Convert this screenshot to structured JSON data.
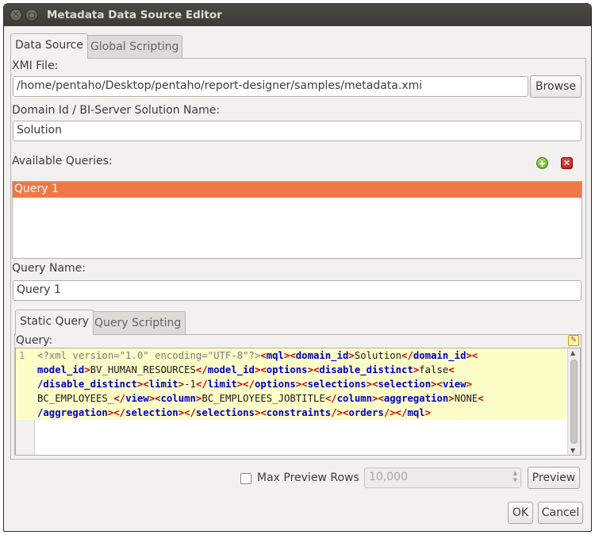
{
  "window": {
    "title": "Metadata Data Source Editor"
  },
  "tabs": [
    {
      "label": "Data Source"
    },
    {
      "label": "Global Scripting"
    }
  ],
  "xmi": {
    "label": "XMI File:",
    "value": "/home/pentaho/Desktop/pentaho/report-designer/samples/metadata.xmi",
    "browse_label": "Browse"
  },
  "domain": {
    "label": "Domain Id / BI-Server Solution Name:",
    "value": "Solution"
  },
  "queries": {
    "label": "Available Queries:",
    "items": [
      "Query 1"
    ]
  },
  "query_name": {
    "label": "Query Name:",
    "value": "Query 1"
  },
  "query_tabs": [
    {
      "label": "Static Query"
    },
    {
      "label": "Query Scripting"
    }
  ],
  "query": {
    "label": "Query:",
    "line_number": "1",
    "lines": [
      [
        [
          "pi",
          "<?xml version=\"1.0\" encoding=\"UTF-8\"?>"
        ],
        [
          "br",
          "<"
        ],
        [
          "tag",
          "mql"
        ],
        [
          "br",
          ">"
        ],
        [
          "br",
          "<"
        ],
        [
          "tag",
          "domain_id"
        ],
        [
          "br",
          ">"
        ],
        [
          "txt",
          "Solution"
        ],
        [
          "br",
          "</"
        ],
        [
          "tag",
          "domain_id"
        ],
        [
          "br",
          ">"
        ],
        [
          "br",
          "<"
        ]
      ],
      [
        [
          "tag",
          "model_id"
        ],
        [
          "br",
          ">"
        ],
        [
          "txt",
          "BV_HUMAN_RESOURCES"
        ],
        [
          "br",
          "</"
        ],
        [
          "tag",
          "model_id"
        ],
        [
          "br",
          ">"
        ],
        [
          "br",
          "<"
        ],
        [
          "tag",
          "options"
        ],
        [
          "br",
          ">"
        ],
        [
          "br",
          "<"
        ],
        [
          "tag",
          "disable_distinct"
        ],
        [
          "br",
          ">"
        ],
        [
          "txt",
          "false"
        ],
        [
          "br",
          "<"
        ]
      ],
      [
        [
          "tag",
          "/disable_distinct"
        ],
        [
          "br",
          ">"
        ],
        [
          "br",
          "<"
        ],
        [
          "tag",
          "limit"
        ],
        [
          "br",
          ">"
        ],
        [
          "txt",
          "-1"
        ],
        [
          "br",
          "</"
        ],
        [
          "tag",
          "limit"
        ],
        [
          "br",
          ">"
        ],
        [
          "br",
          "</"
        ],
        [
          "tag",
          "options"
        ],
        [
          "br",
          ">"
        ],
        [
          "br",
          "<"
        ],
        [
          "tag",
          "selections"
        ],
        [
          "br",
          ">"
        ],
        [
          "br",
          "<"
        ],
        [
          "tag",
          "selection"
        ],
        [
          "br",
          ">"
        ],
        [
          "br",
          "<"
        ],
        [
          "tag",
          "view"
        ],
        [
          "br",
          ">"
        ]
      ],
      [
        [
          "txt",
          "BC_EMPLOYEES_"
        ],
        [
          "br",
          "</"
        ],
        [
          "tag",
          "view"
        ],
        [
          "br",
          ">"
        ],
        [
          "br",
          "<"
        ],
        [
          "tag",
          "column"
        ],
        [
          "br",
          ">"
        ],
        [
          "txt",
          "BC_EMPLOYEES_JOBTITLE"
        ],
        [
          "br",
          "</"
        ],
        [
          "tag",
          "column"
        ],
        [
          "br",
          ">"
        ],
        [
          "br",
          "<"
        ],
        [
          "tag",
          "aggregation"
        ],
        [
          "br",
          ">"
        ],
        [
          "txt",
          "NONE"
        ],
        [
          "br",
          "<"
        ]
      ],
      [
        [
          "tag",
          "/aggregation"
        ],
        [
          "br",
          ">"
        ],
        [
          "br",
          "</"
        ],
        [
          "tag",
          "selection"
        ],
        [
          "br",
          ">"
        ],
        [
          "br",
          "</"
        ],
        [
          "tag",
          "selections"
        ],
        [
          "br",
          ">"
        ],
        [
          "br",
          "<"
        ],
        [
          "tag",
          "constraints"
        ],
        [
          "br",
          "/>"
        ],
        [
          "br",
          "<"
        ],
        [
          "tag",
          "orders"
        ],
        [
          "br",
          "/>"
        ],
        [
          "br",
          "</"
        ],
        [
          "tag",
          "mql"
        ],
        [
          "br",
          ">"
        ]
      ]
    ]
  },
  "preview": {
    "max_rows_label": "Max Preview Rows",
    "max_rows_value": "10,000",
    "max_rows_checked": false,
    "preview_label": "Preview"
  },
  "footer": {
    "ok_label": "OK",
    "cancel_label": "Cancel"
  },
  "colors": {
    "selection": "#f07746",
    "editor_highlight": "#fdfdc8",
    "tag": "#0000c8",
    "bracket": "#cc0000"
  },
  "icons": {
    "add_query": "add-icon",
    "remove_query": "remove-icon",
    "edit_query": "pencil-icon"
  }
}
